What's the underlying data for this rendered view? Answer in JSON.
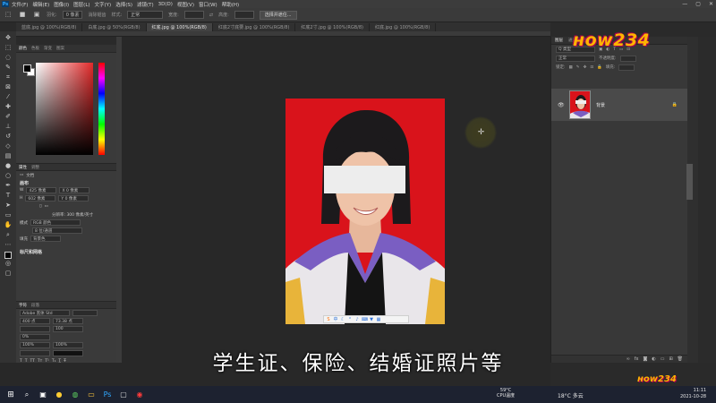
{
  "menubar": {
    "items": [
      "文件(F)",
      "编辑(E)",
      "图像(I)",
      "图层(L)",
      "文字(Y)",
      "选择(S)",
      "滤镜(T)",
      "3D(D)",
      "视图(V)",
      "窗口(W)",
      "帮助(H)"
    ],
    "window_buttons": [
      "—",
      "▢",
      "✕"
    ]
  },
  "options": {
    "feather_label": "羽化:",
    "feather_value": "0 像素",
    "antialias_label": "消除锯齿",
    "style_label": "样式:",
    "style_value": "正常",
    "width_label": "宽度:",
    "height_label": "高度:",
    "select_mask_button": "选择并遮住..."
  },
  "tabs": [
    {
      "label": "蓝底.jpg @ 100%(RGB/8)",
      "active": false
    },
    {
      "label": "白底.jpg @ 50%(RGB/8)",
      "active": false
    },
    {
      "label": "红底.jpg @ 100%(RGB/8)",
      "active": true
    },
    {
      "label": "红底2寸底要.jpg @ 100%(RGB/8)",
      "active": false
    },
    {
      "label": "红底2寸.jpg @ 100%(RGB/8)",
      "active": false
    },
    {
      "label": "红底.jpg @ 100%(RGB/8)",
      "active": false
    }
  ],
  "left_panel": {
    "color_tabs": [
      "颜色",
      "色板",
      "渐变",
      "图案"
    ],
    "properties_tabs": [
      "属性",
      "调整"
    ],
    "doc_label": "文档",
    "canvas_heading": "画布",
    "width_letter": "W",
    "width_value": "425 像素",
    "x_placeholder": "X 0 像素",
    "height_letter": "H",
    "height_value": "602 像素",
    "y_placeholder": "Y 0 像素",
    "resolution": "分辨率: 300 像素/英寸",
    "mode_label": "模式",
    "mode_value": "RGB 颜色",
    "depth_value": "8 位/通道",
    "fill_label": "填充",
    "fill_value": "背景色",
    "rulers_heading": "标尺和网格",
    "char_tabs": [
      "字符",
      "段落"
    ],
    "font_family": "Adobe 黑体 Std",
    "font_size": "400 点",
    "leading": "73.38 点",
    "tracking": "100",
    "vscale": "0%",
    "hscale_a": "100%",
    "hscale_b": "100%"
  },
  "right_panel": {
    "tabs": [
      "图层",
      "通道",
      "路径"
    ],
    "kind_field": "Q 类型",
    "blend_mode": "正常",
    "opacity_label": "不透明度:",
    "lock_label": "锁定:",
    "fill_label": "填充:",
    "layer_name": "背景"
  },
  "canvas": {
    "background_color": "#d9131b",
    "subtitle": "学生证、保险、结婚证照片等"
  },
  "watermark": {
    "logo": "ноw234"
  },
  "taskbar": {
    "cpu_temp": "59°C",
    "cpu_label": "CPU温度",
    "weather": "18°C 多云",
    "time": "11:11",
    "date": "2021-10-28"
  }
}
